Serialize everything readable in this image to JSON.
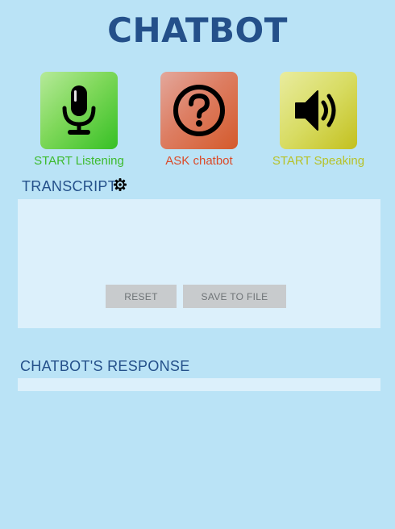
{
  "app": {
    "title": "CHATBOT"
  },
  "actions": [
    {
      "label": "START Listening",
      "icon": "microphone-icon",
      "color": "#3dbb2e"
    },
    {
      "label": "ASK chatbot",
      "icon": "question-icon",
      "color": "#db4a28"
    },
    {
      "label": "START Speaking",
      "icon": "speaker-icon",
      "color": "#b7c229"
    }
  ],
  "transcript": {
    "heading": "TRANSCRIPT",
    "text": "",
    "settings_icon": "gear-icon",
    "reset_label": "RESET",
    "save_label": "SAVE TO FILE"
  },
  "response": {
    "heading": "CHATBOT'S RESPONSE",
    "text": ""
  },
  "colors": {
    "background": "#bae3f6",
    "panel": "#dcf0fb",
    "title": "#24508a",
    "button": "#c8cbcd"
  }
}
